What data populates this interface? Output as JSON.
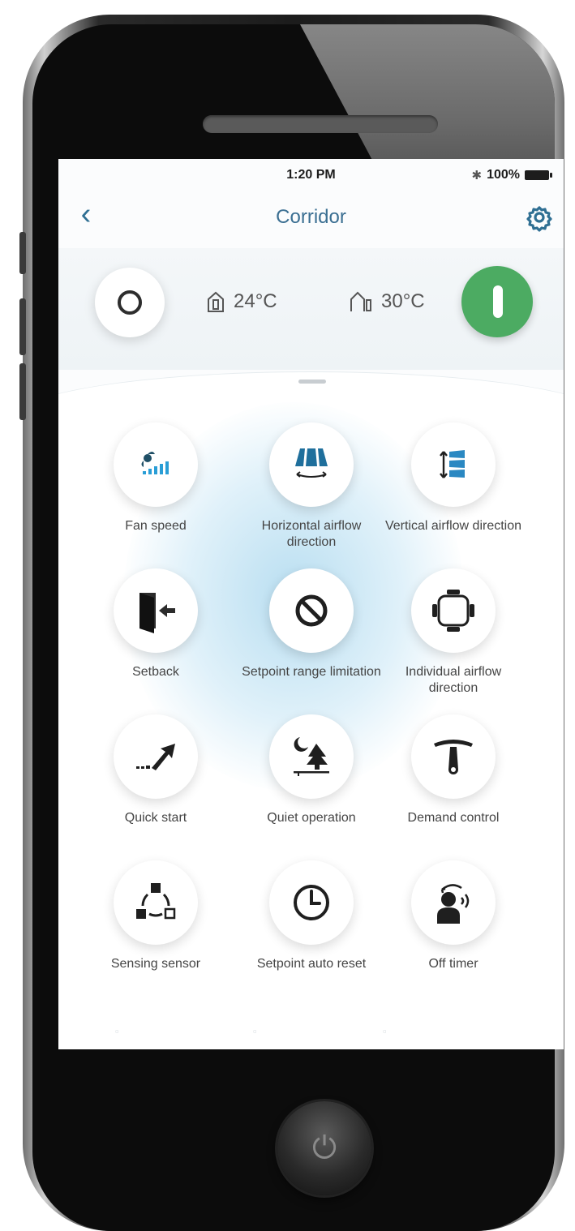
{
  "status_bar": {
    "time": "1:20 PM",
    "battery": "100%"
  },
  "header": {
    "title": "Corridor"
  },
  "temperatures": {
    "indoor": "24°C",
    "outdoor": "30°C"
  },
  "colors": {
    "accent": "#3b6f92",
    "power_on": "#4cab62",
    "glow": "#a1d3ec"
  },
  "functions": [
    {
      "label": "Fan speed",
      "icon": "fan-speed-icon"
    },
    {
      "label": "Horizontal airflow direction",
      "icon": "horizontal-airflow-icon"
    },
    {
      "label": "Vertical airflow direction",
      "icon": "vertical-airflow-icon"
    },
    {
      "label": "Setback",
      "icon": "setback-door-icon"
    },
    {
      "label": "Setpoint range limitation",
      "icon": "prohibited-icon"
    },
    {
      "label": "Individual airflow direction",
      "icon": "individual-airflow-icon"
    },
    {
      "label": "Quick start",
      "icon": "quick-start-arrow-icon"
    },
    {
      "label": "Quiet operation",
      "icon": "quiet-moon-tree-icon"
    },
    {
      "label": "Demand control",
      "icon": "demand-gauge-icon"
    },
    {
      "label": "Sensing sensor",
      "icon": "sensing-sensor-icon"
    },
    {
      "label": "Setpoint auto reset",
      "icon": "clock-icon"
    },
    {
      "label": "Off timer",
      "icon": "off-timer-person-icon"
    }
  ]
}
